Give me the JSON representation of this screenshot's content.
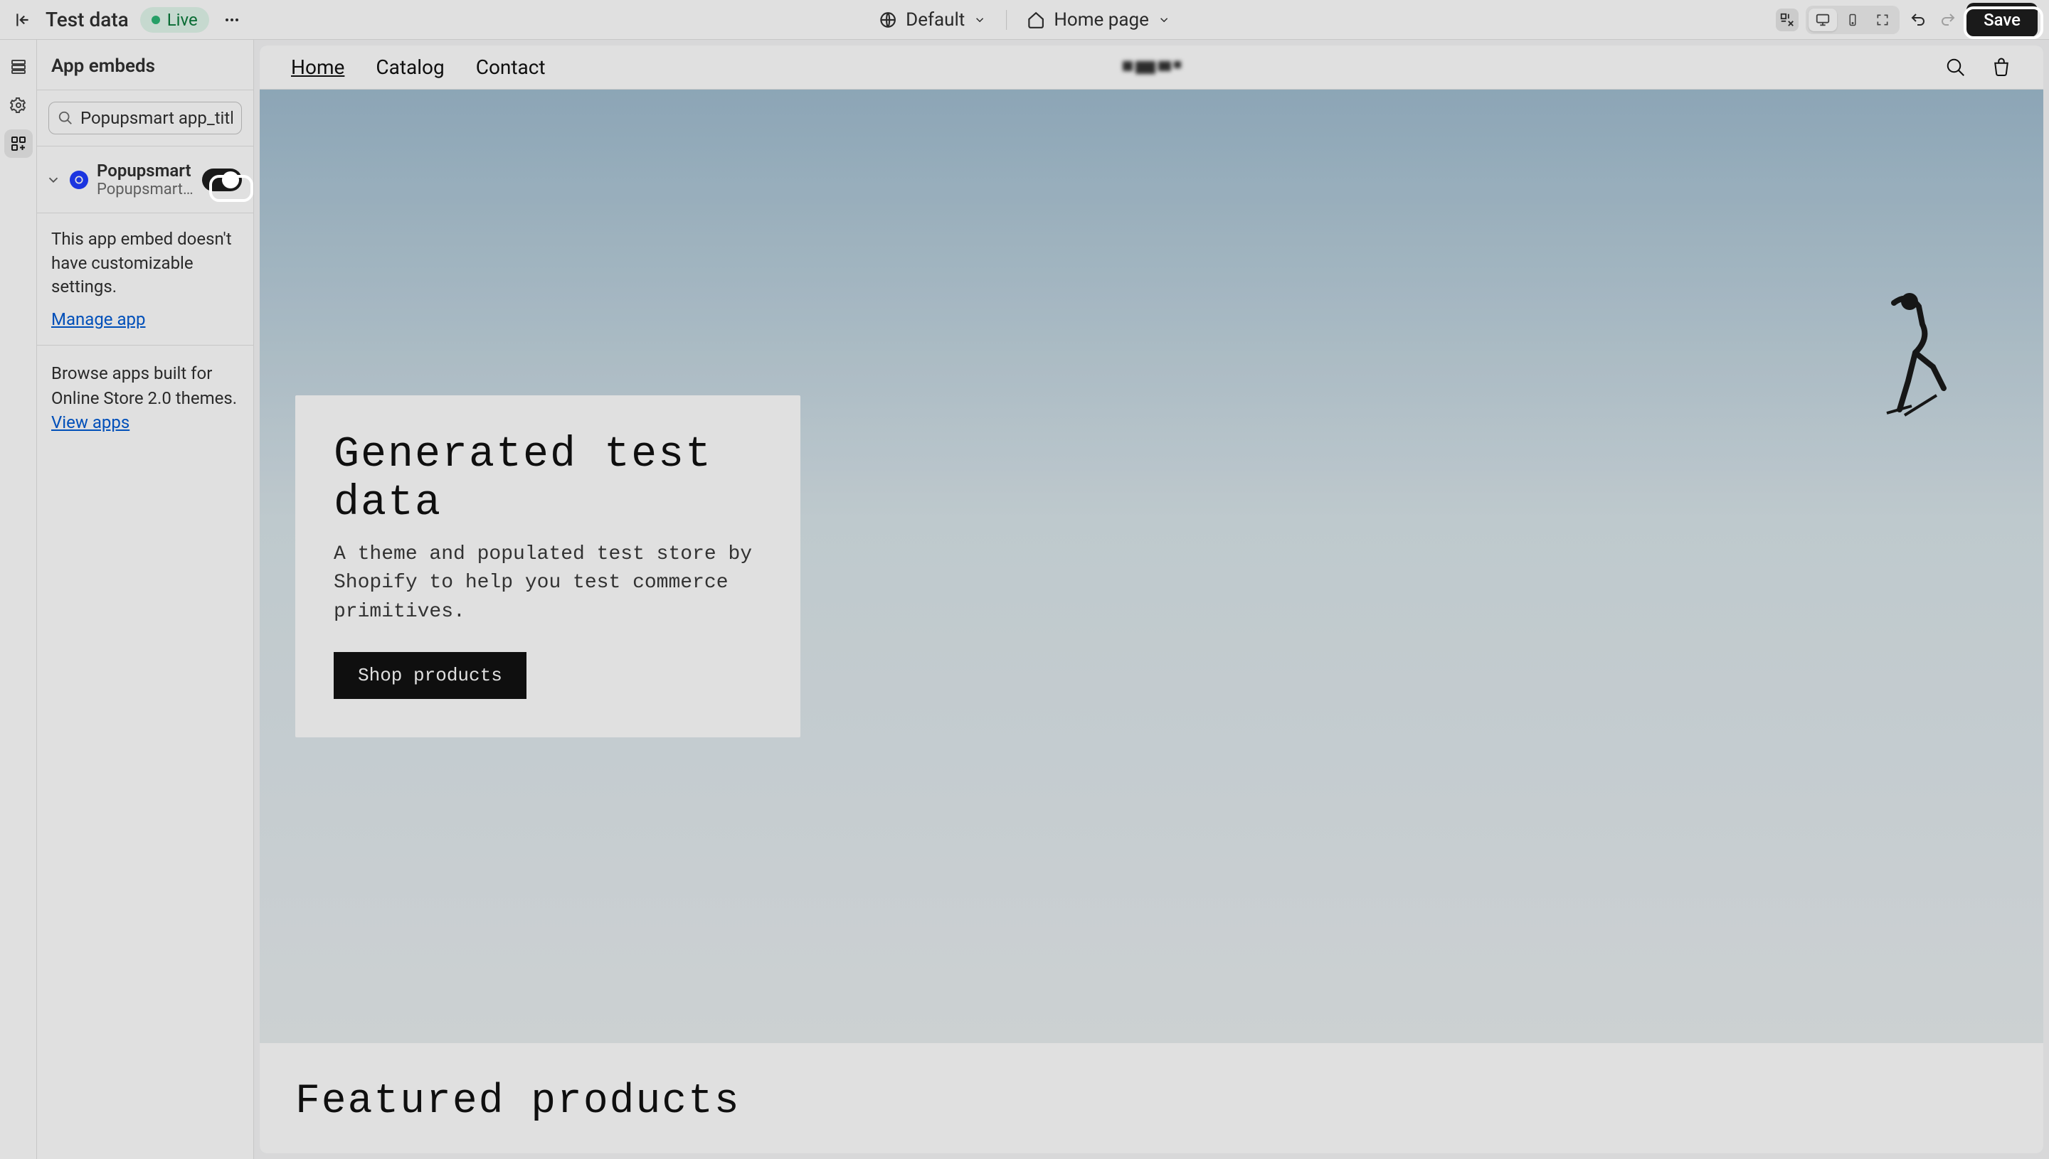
{
  "topbar": {
    "title": "Test data",
    "live_badge": "Live",
    "locale_label": "Default",
    "page_label": "Home page",
    "save_label": "Save"
  },
  "panel": {
    "title": "App embeds",
    "search_value": "Popupsmart app_title:'Popupsmart'",
    "embed": {
      "name": "Popupsmart",
      "subtitle": "Popupsmart:Popup, Sales, ...",
      "enabled": true,
      "description": "This app embed doesn't have customizable settings.",
      "manage_label": "Manage app"
    },
    "browse_text": "Browse apps built for Online Store 2.0 themes. ",
    "view_apps_label": "View apps"
  },
  "store": {
    "nav": [
      "Home",
      "Catalog",
      "Contact"
    ],
    "hero_title": "Generated test data",
    "hero_subtitle": "A theme and populated test store by Shopify to help you test commerce primitives.",
    "cta_label": "Shop products",
    "featured_title": "Featured products"
  }
}
